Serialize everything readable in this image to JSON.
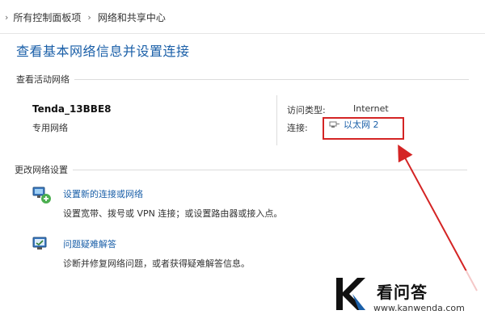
{
  "breadcrumb": {
    "items": [
      "所有控制面板项",
      "网络和共享中心"
    ]
  },
  "page_title": "查看基本网络信息并设置连接",
  "active_networks": {
    "section_title": "查看活动网络",
    "network_name": "Tenda_13BBE8",
    "network_type": "专用网络",
    "access_type_label": "访问类型:",
    "access_type_value": "Internet",
    "connection_label": "连接:",
    "connection_value": "以太网 2"
  },
  "change_settings": {
    "section_title": "更改网络设置",
    "tasks": [
      {
        "title": "设置新的连接或网络",
        "description": "设置宽带、拨号或 VPN 连接；或设置路由器或接入点。",
        "icon": "network-setup-icon"
      },
      {
        "title": "问题疑难解答",
        "description": "诊断并修复网络问题，或者获得疑难解答信息。",
        "icon": "troubleshoot-icon"
      }
    ]
  },
  "watermark": {
    "title": "看问答",
    "url": "www.kanwenda.com"
  },
  "colors": {
    "link": "#1a5fa8",
    "highlight": "#d42424"
  }
}
